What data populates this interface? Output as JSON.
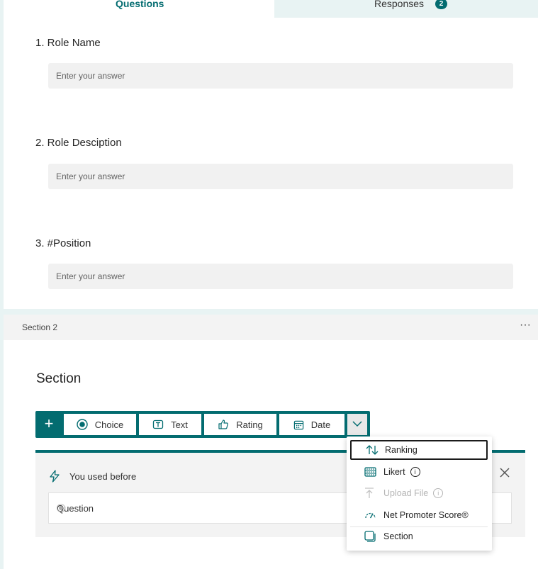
{
  "tabs": {
    "questions_label": "Questions",
    "responses_label": "Responses",
    "responses_count": "2"
  },
  "questions": [
    {
      "title": "1. Role Name",
      "placeholder": "Enter your answer"
    },
    {
      "title": "2. Role Desciption",
      "placeholder": "Enter your answer"
    },
    {
      "title": "3. #Position",
      "placeholder": "Enter your answer"
    }
  ],
  "section_bar": {
    "label": "Section 2",
    "more": "···"
  },
  "section_heading": "Section",
  "toolbar": {
    "add": "+",
    "choice_label": "Choice",
    "text_label": "Text",
    "rating_label": "Rating",
    "date_label": "Date"
  },
  "card": {
    "used_before_label": "You used before",
    "question_label": "Question"
  },
  "dropdown": {
    "ranking_label": "Ranking",
    "likert_label": "Likert",
    "upload_label": "Upload File",
    "nps_label": "Net Promoter Score®",
    "section_label": "Section"
  },
  "colors": {
    "accent": "#036c70",
    "tab_inactive_bg": "#e8f3f3",
    "answer_bg": "#f1f1f1"
  },
  "icons": {
    "choice": "radio-icon",
    "text": "text-box-icon",
    "rating": "thumbs-up-icon",
    "date": "calendar-icon",
    "ranking": "sort-arrows-icon",
    "likert": "grid-icon",
    "upload": "upload-icon",
    "nps": "gauge-icon",
    "section": "section-icon"
  }
}
